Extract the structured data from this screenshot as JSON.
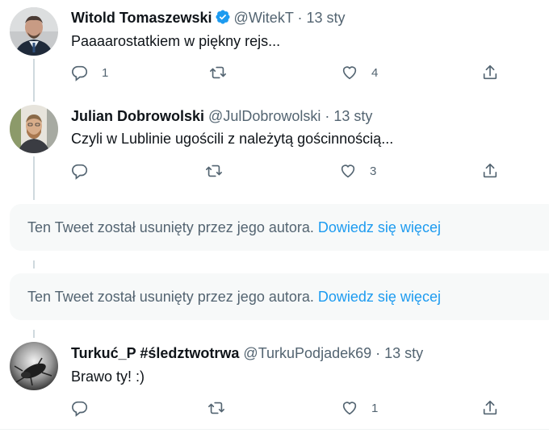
{
  "tweets": [
    {
      "name": "Witold Tomaszewski",
      "handle": "@WitekT",
      "dot": "·",
      "time": "13 sty",
      "verified": true,
      "text": "Paaaarostatkiem w piękny rejs...",
      "replies": "1",
      "retweets": "",
      "likes": "4"
    },
    {
      "name": "Julian Dobrowolski",
      "handle": "@JulDobrowolski",
      "dot": "·",
      "time": "13 sty",
      "verified": false,
      "text": "Czyli w Lublinie ugościli z należytą gościnnością...",
      "replies": "",
      "retweets": "",
      "likes": "3"
    },
    {
      "name": "Turkuć_P #śledztwotrwa",
      "handle": "@TurkuPodjadek69",
      "dot": "·",
      "time": "13 sty",
      "verified": false,
      "text": "Brawo ty! :)",
      "replies": "",
      "retweets": "",
      "likes": "1"
    }
  ],
  "deleted_notices": [
    {
      "text": "Ten Tweet został usunięty przez jego autora.",
      "link": "Dowiedz się więcej"
    },
    {
      "text": "Ten Tweet został usunięty przez jego autora.",
      "link": "Dowiedz się więcej"
    }
  ],
  "colors": {
    "accent": "#1d9bf0",
    "secondary_text": "#536471",
    "deleted_bg": "#f7f9f9"
  },
  "icons": [
    "reply-icon",
    "retweet-icon",
    "like-icon",
    "share-icon",
    "verified-badge-icon"
  ]
}
